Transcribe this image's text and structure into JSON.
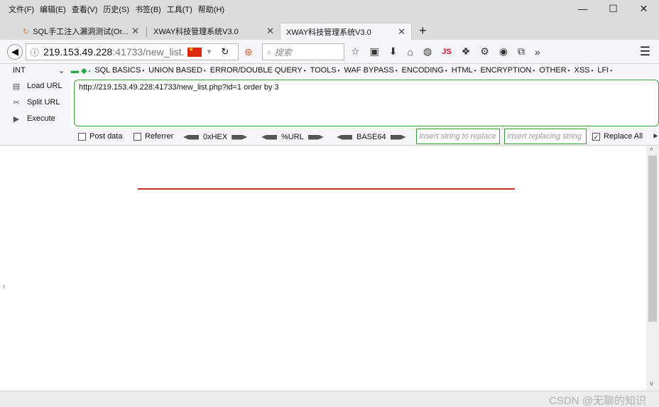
{
  "menu": [
    "文件(F)",
    "编辑(E)",
    "查看(V)",
    "历史(S)",
    "书签(B)",
    "工具(T)",
    "帮助(H)"
  ],
  "window_controls": [
    "—",
    "☐",
    "✕"
  ],
  "tabs": [
    {
      "label": "SQL手工注入漏洞测试(Or...",
      "close": "✕"
    },
    {
      "label": "XWAY科技管理系统V3.0",
      "close": "✕"
    },
    {
      "label": "XWAY科技管理系统V3.0",
      "close": "✕"
    }
  ],
  "newtab": "+",
  "nav": {
    "url_host": "219.153.49.228",
    "url_path": ":41733/new_list.",
    "search_placeholder": "搜索",
    "js_label": "JS"
  },
  "hackbar": {
    "int_label": "INT",
    "menus": [
      "SQL BASICS",
      "UNION BASED",
      "ERROR/DOUBLE QUERY",
      "TOOLS",
      "WAF BYPASS",
      "ENCODING",
      "HTML",
      "ENCRYPTION",
      "OTHER",
      "XSS",
      "LFI"
    ],
    "load_url": "Load URL",
    "split_url": "Split URL",
    "execute": "Execute",
    "url_value": "http://219.153.49.228:41733/new_list.php?id=1 order by 3",
    "post_data": "Post data",
    "referrer": "Referrer",
    "hex": "0xHEX",
    "url_enc": "%URL",
    "base64": "BASE64",
    "replace_placeholder": "Insert string to replace",
    "replacing_placeholder": "Insert replacing string",
    "replace_all": "Replace All"
  },
  "watermark": "CSDN @无聊的知识"
}
